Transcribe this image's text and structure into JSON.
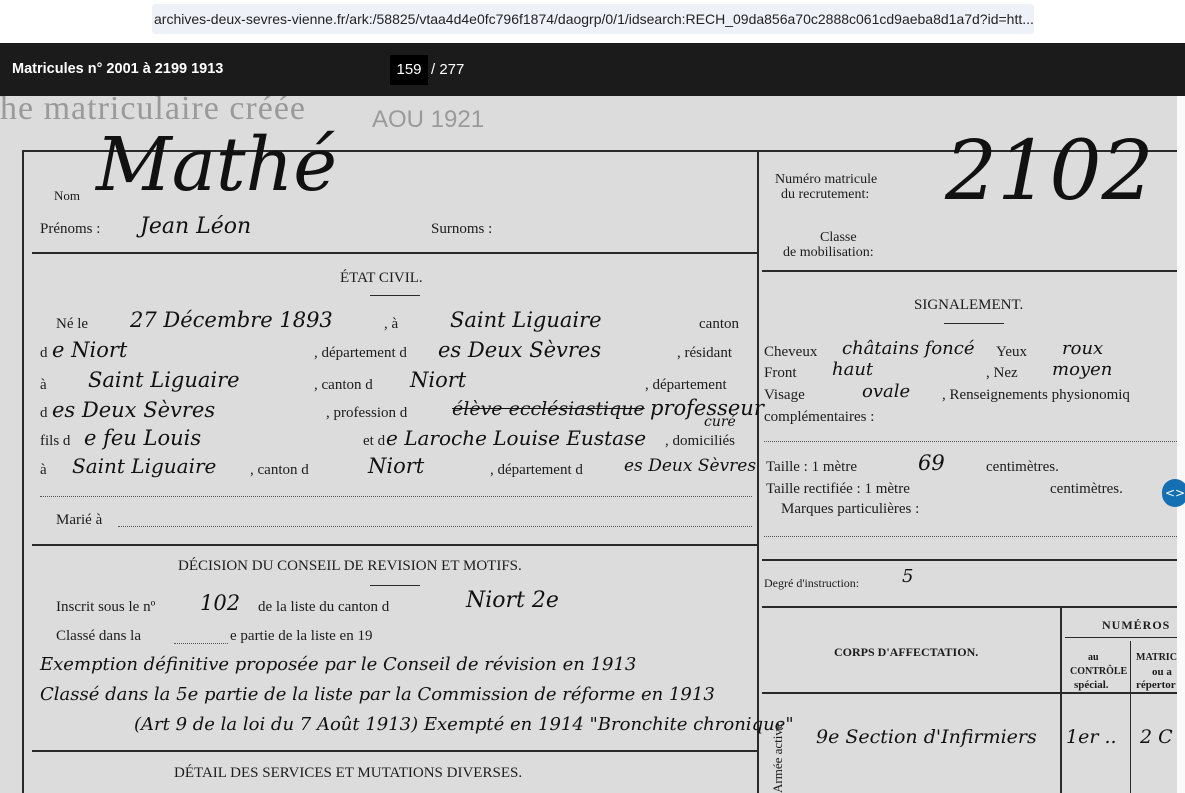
{
  "browser": {
    "url": "archives-deux-sevres-vienne.fr/ark:/58825/vtaa4d4e0fc796f1874/daogrp/0/1/idsearch:RECH_09da856a70c2888c061cd9aeba8d1a7d?id=htt..."
  },
  "viewer": {
    "title": "Matricules n° 2001 à 2199 1913",
    "page_current": "159",
    "page_total": "/ 277",
    "toggle_icon": "<>"
  },
  "document": {
    "stamp_header": "he matriculaire créée",
    "stamp_date": "AOU 1921",
    "surname_label": "Nom",
    "surname_value": "Mathé",
    "firstname_label": "Prénoms :",
    "firstname_value": "Jean Léon",
    "nickname_label": "Surnoms :",
    "civil_heading": "ÉTAT CIVIL.",
    "born_label": "Né le",
    "born_value": "27 Décembre 1893",
    "born_a": ", à",
    "born_place": "Saint Liguaire",
    "canton_label_1": "canton",
    "de_label": "d",
    "canton_value_1": "e Niort",
    "department_label": ", département d",
    "department_value": "es Deux Sèvres",
    "resident_label": ", résidant",
    "a_label": "à",
    "resident_place": "Saint Liguaire",
    "canton_label_2": ", canton d",
    "canton_value_2": "Niort",
    "department_label_2": ", département",
    "department_value_2": "es Deux Sèvres",
    "profession_label": ", profession d",
    "profession_struck": "élève ecclésiastique",
    "profession_value": "professeur",
    "profession_note": "curé",
    "father_label": "fils d",
    "father_value": "e feu Louis",
    "mother_label": "et d",
    "mother_value": "e Laroche Louise Eustase",
    "domiciled_label": ", domiciliés",
    "domicile_place": "Saint Liguaire",
    "canton_label_3": ", canton d",
    "canton_value_3": "Niort",
    "department_label_3": ", département d",
    "department_value_3": "es Deux Sèvres",
    "married_label": "Marié à",
    "decision_heading": "DÉCISION DU CONSEIL DE REVISION ET MOTIFS.",
    "registered_label": "Inscrit sous le nº",
    "registered_number": "102",
    "list_label": "de la liste du canton d",
    "list_value": "Niort 2e",
    "class_label": "Classé dans la",
    "class_part": "e partie de la liste en 19",
    "decision_line_1": "Exemption définitive proposée par le Conseil de révision en 1913",
    "decision_line_2": "Classé dans la 5e partie de la liste par la Commission de réforme en 1913",
    "decision_line_3": "(Art 9 de la loi du 7 Août 1913) Exempté en 1914 \"Bronchite chronique\"",
    "services_heading": "DÉTAIL DES SERVICES ET MUTATIONS DIVERSES.",
    "matricule_label_1": "Numéro matricule",
    "matricule_label_2": "du recrutement:",
    "matricule_value": "2102",
    "mobil_label_1": "Classe",
    "mobil_label_2": "de mobilisation:",
    "signal_heading": "SIGNALEMENT.",
    "hair_label": "Cheveux",
    "hair_value": "châtains foncé",
    "eyes_label": "Yeux",
    "eyes_value": "roux",
    "forehead_label": "Front",
    "forehead_value": "haut",
    "nose_label": ", Nez",
    "nose_value": "moyen",
    "face_label": "Visage",
    "face_value": "ovale",
    "physio_label": ", Renseignements physionomiq",
    "complementary_label": "complémentaires :",
    "height_label": "Taille : 1 mètre",
    "height_value": "69",
    "height_unit": "centimètres.",
    "height_corr_label": "Taille rectifiée : 1 mètre",
    "height_corr_unit": "centimètres.",
    "marks_label": "Marques particulières :",
    "instruction_label": "Degré d'instruction:",
    "instruction_value": "5",
    "numbers_heading": "NUMÉROS",
    "corps_heading": "CORPS D'AFFECTATION.",
    "control_label_1": "au",
    "control_label_2": "CONTRÔLE",
    "control_label_3": "spécial.",
    "matric_label_1": "MATRIC",
    "matric_label_2": "ou a",
    "matric_label_3": "répertor",
    "army_label": "Armée active.",
    "unit_value": "9e Section d'Infirmiers",
    "unit_number": "1er ..",
    "unit_number_2": "2 C"
  }
}
